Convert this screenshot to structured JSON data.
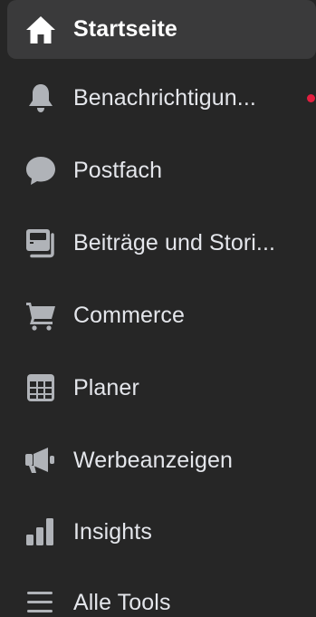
{
  "colors": {
    "background": "#262626",
    "active_background": "#3a3a3b",
    "icon": "#b0b3b8",
    "text": "#e4e6eb",
    "active_text": "#ffffff",
    "notification_dot": "#e41e3f"
  },
  "nav": {
    "items": [
      {
        "label": "Startseite",
        "icon": "home-icon",
        "active": true
      },
      {
        "label": "Benachrichtigun...",
        "icon": "bell-icon",
        "has_notification": true
      },
      {
        "label": "Postfach",
        "icon": "chat-bubble-icon"
      },
      {
        "label": "Beiträge und Stori...",
        "icon": "posts-stories-icon"
      },
      {
        "label": "Commerce",
        "icon": "cart-icon"
      },
      {
        "label": "Planer",
        "icon": "calendar-grid-icon"
      },
      {
        "label": "Werbeanzeigen",
        "icon": "megaphone-icon"
      },
      {
        "label": "Insights",
        "icon": "bar-chart-icon"
      },
      {
        "label": "Alle Tools",
        "icon": "menu-lines-icon"
      }
    ]
  }
}
